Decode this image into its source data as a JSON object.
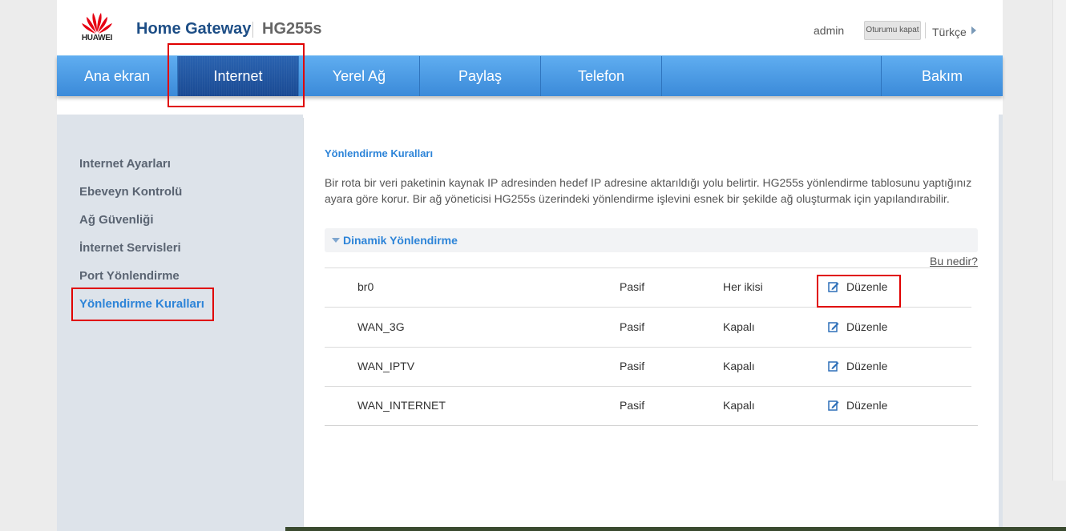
{
  "header": {
    "logo_text": "HUAWEI",
    "brand": "Home Gateway",
    "model": "HG255s",
    "user": "admin",
    "logout_label": "Oturumu kapat",
    "language": "Türkçe"
  },
  "nav": {
    "items": [
      "Ana ekran",
      "Internet",
      "Yerel Ağ",
      "Paylaş",
      "Telefon",
      "Bakım"
    ],
    "active": "Internet"
  },
  "sidebar": {
    "items": [
      "Internet Ayarları",
      "Ebeveyn Kontrolü",
      "Ağ Güvenliği",
      "İnternet Servisleri",
      "Port Yönlendirme",
      "Yönlendirme Kuralları"
    ],
    "active": "Yönlendirme Kuralları"
  },
  "main": {
    "title": "Yönlendirme Kuralları",
    "description": "Bir rota bir veri paketinin kaynak IP adresinden hedef IP adresine aktarıldığı yolu belirtir. HG255s yönlendirme tablosunu yaptığınız ayara göre korur. Bir ağ yöneticisi HG255s üzerindeki yönlendirme işlevini esnek bir şekilde ağ oluşturmak için yapılandırabilir.",
    "section_label": "Dinamik Yönlendirme",
    "help_link": "Bu nedir?",
    "rows": [
      {
        "name": "br0",
        "state": "Pasif",
        "direction": "Her ikisi",
        "edit": "Düzenle"
      },
      {
        "name": "WAN_3G",
        "state": "Pasif",
        "direction": "Kapalı",
        "edit": "Düzenle"
      },
      {
        "name": "WAN_IPTV",
        "state": "Pasif",
        "direction": "Kapalı",
        "edit": "Düzenle"
      },
      {
        "name": "WAN_INTERNET",
        "state": "Pasif",
        "direction": "Kapalı",
        "edit": "Düzenle"
      }
    ]
  },
  "colors": {
    "accent": "#2d84d8",
    "nav": "#4a9be6",
    "nav_active": "#1f4f97",
    "highlight_box": "#e00000",
    "brand": "#1d4e86"
  }
}
